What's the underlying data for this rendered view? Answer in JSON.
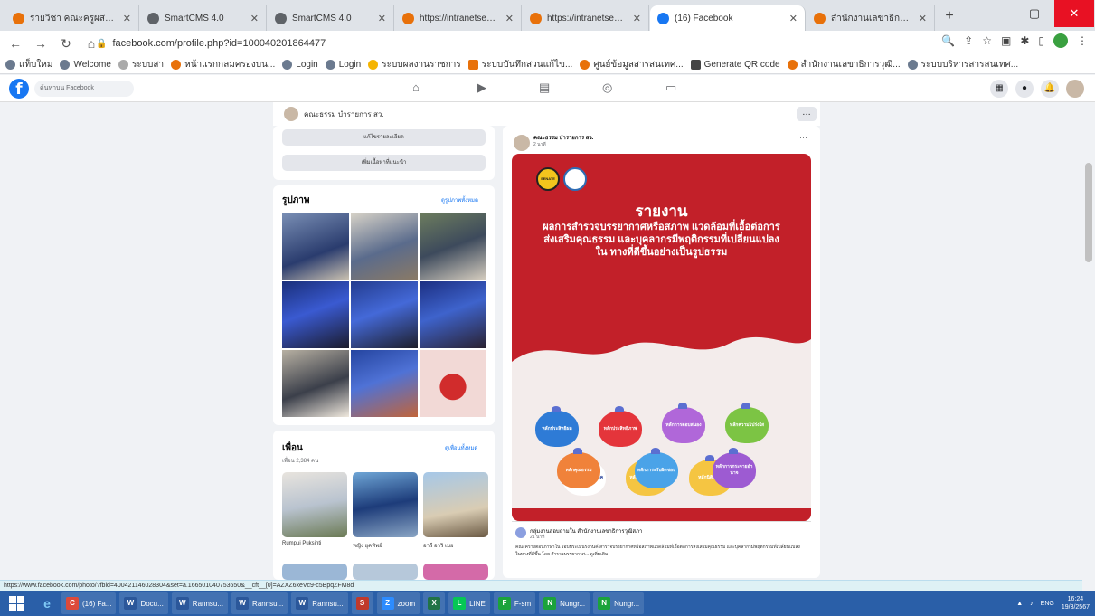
{
  "browser": {
    "tabs": [
      {
        "title": "รายวิชา คณะครูผสอนภาษา",
        "color": "#e8710a"
      },
      {
        "title": "SmartCMS 4.0",
        "color": "#5f6368"
      },
      {
        "title": "SmartCMS 4.0",
        "color": "#5f6368"
      },
      {
        "title": "https://intranetsenate.",
        "color": "#e8710a"
      },
      {
        "title": "https://intranetsenate",
        "color": "#e8710a"
      },
      {
        "title": "(16) Facebook",
        "color": "#1877f2"
      },
      {
        "title": "สำนักงานเลขาธิการวุฒิสภา",
        "color": "#e8710a"
      }
    ],
    "url": "facebook.com/profile.php?id=100040201864477",
    "bookmarks": [
      "แท็บใหม่",
      "Welcome",
      "ระบบสา",
      "หน้าแรกกลมครองบน...",
      "Login",
      "Login",
      "ระบบผลงานราชการ",
      "ระบบบันทึกสวนแก้ไข...",
      "ศูนย์ข้อมูลสารสนเทศ...",
      "Generate QR code",
      "สำนักงานเลขาธิการวุฒิ...",
      "ระบบบริหารสารสนเทศ..."
    ]
  },
  "facebook": {
    "search_placeholder": "ค้นหาบน Facebook",
    "profile_name": "คณะธรรม บำรายการ สว.",
    "edit_details": "แก้ไขรายละเอียด",
    "add_featured": "เพิ่มเนื้อหาที่แนะนำ",
    "photos_title": "รูปภาพ",
    "photos_link": "ดูรูปภาพทั้งหมด",
    "friends_title": "เพื่อน",
    "friends_count": "เพื่อน 2,384 คน",
    "friends_link": "ดูเพื่อนทั้งหมด",
    "friends": [
      "Rumpui Puksinti",
      "หญิง ยุคทิพย์",
      "อาวี อาวิ เมย"
    ]
  },
  "post": {
    "author": "คณะธรรม บำรายการ สว.",
    "time": "2 นาที",
    "poster_logo": "SENATE",
    "poster_title": "รายงาน",
    "poster_subtitle": "ผลการสำรวจบรรยากาศหรือสภาพ แวดล้อมที่เอื้อต่อการส่งเสริมคุณธรรม และบุคลากรมีพฤติกรรมที่เปลี่ยนแปลงใน ทางที่ดีขึ้นอย่างเป็นรูปธรรม",
    "bags": [
      {
        "label": "หลักประสิทธิผล",
        "color": "#2e7bd6"
      },
      {
        "label": "หลักประสิทธิภาพ",
        "color": "#e4353b"
      },
      {
        "label": "หลักการตอบสนอง",
        "color": "#b067d9"
      },
      {
        "label": "หลักความโปร่งใส",
        "color": "#7cc444"
      },
      {
        "label": "หลักความเสมอภาค",
        "color": "#ffffff"
      },
      {
        "label": "หลักการมีส่วนร่วม",
        "color": "#f5c542"
      },
      {
        "label": "หลักนิติธรรม",
        "color": "#f5c542"
      },
      {
        "label": "หลักคุณธรรม",
        "color": "#f0823a"
      },
      {
        "label": "หลักภาระรับผิดชอบ",
        "color": "#4aa3e8"
      },
      {
        "label": "หลักการกระจายอำนาจ",
        "color": "#9d5bd2"
      }
    ],
    "shared_name": "กลุ่มงานสอบถามใน สำนักงานเลขาธิการวุฒิสภา",
    "shared_time": "21 นาที",
    "shared_text": "คณะครางตอบภาษาใน รอบประเมินรังกันค์ สำรวจบรรยากาศหรือสภาพแวดล้อมที่เอื้อต่อการส่งเสริมคุณธรรม และบุคลากรมีพฤติกรรมที่เปลี่ยนแปลงในทางที่ดีขึ้น โดย สำรวจบรรยากาศ... ดูเพิ่มเติม"
  },
  "status_url": "https://www.facebook.com/photo/?fbid=400421146028304&set=a.166501040753650&__cft__[0]=AZXZ6xeVc9-c5BpqZFM8d",
  "taskbar": {
    "items": [
      {
        "label": "(16) Fa...",
        "color": "#dd4a3a",
        "icon": "C"
      },
      {
        "label": "Docu...",
        "color": "#2b579a",
        "icon": "W"
      },
      {
        "label": "Rannsu...",
        "color": "#2b579a",
        "icon": "W"
      },
      {
        "label": "Rannsu...",
        "color": "#2b579a",
        "icon": "W"
      },
      {
        "label": "Rannsu...",
        "color": "#2b579a",
        "icon": "W"
      },
      {
        "label": "",
        "color": "#c0392b",
        "icon": "S"
      },
      {
        "label": "zoom",
        "color": "#2d8cff",
        "icon": "Z"
      },
      {
        "label": "",
        "color": "#217346",
        "icon": "X"
      },
      {
        "label": "LINE",
        "color": "#06c755",
        "icon": "L"
      },
      {
        "label": "F-sm",
        "color": "#1ba33b",
        "icon": "F"
      },
      {
        "label": "Nungr...",
        "color": "#1ba33b",
        "icon": "N"
      },
      {
        "label": "Nungr...",
        "color": "#1ba33b",
        "icon": "N"
      }
    ],
    "lang": "ENG",
    "time": "16:24",
    "date": "19/3/2567"
  }
}
